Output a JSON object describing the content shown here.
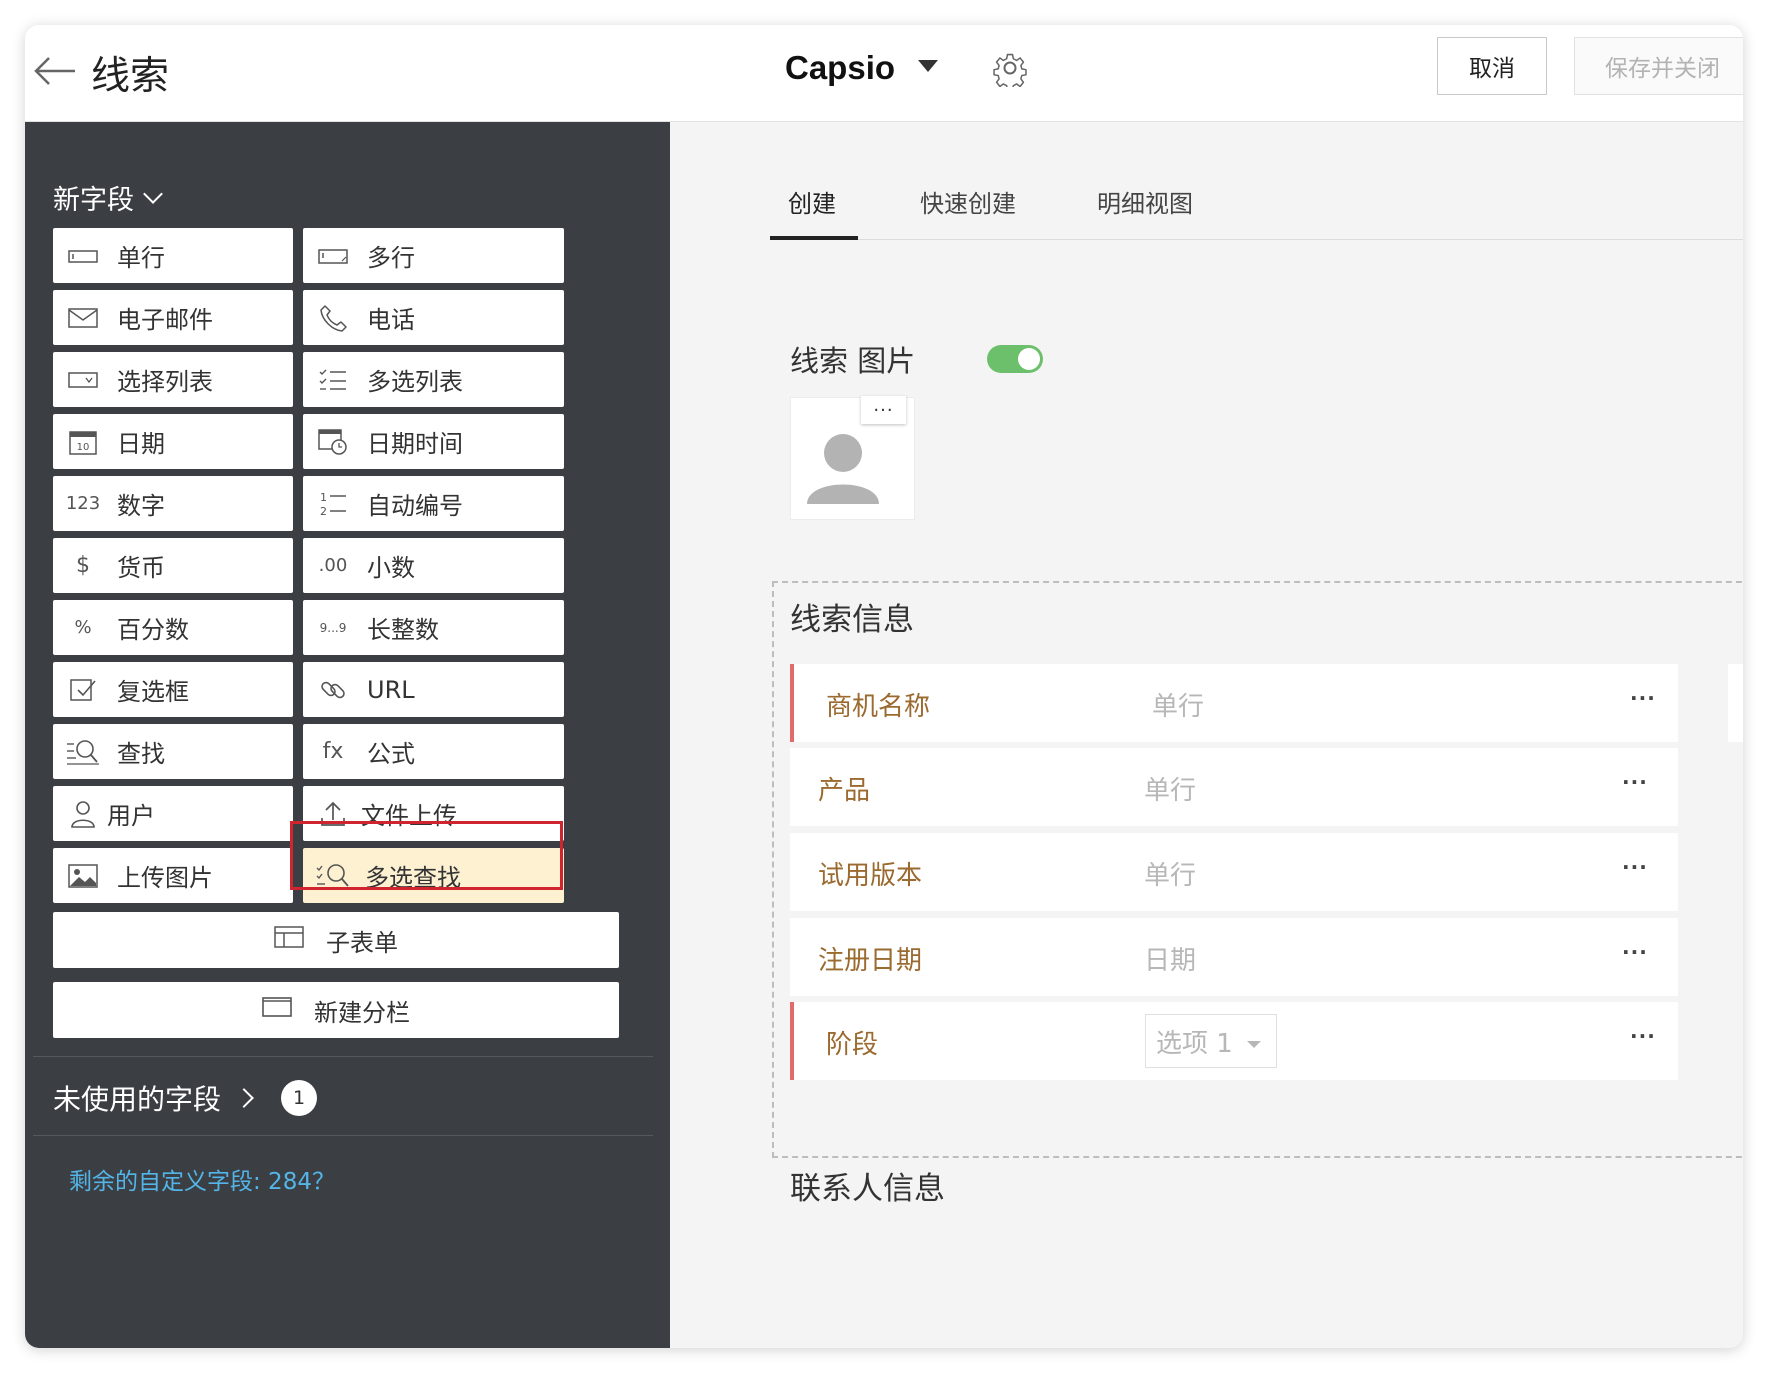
{
  "header": {
    "title": "线索",
    "layout_name": "Capsio",
    "cancel_label": "取消",
    "save_label": "保存并关闭"
  },
  "sidebar": {
    "new_field_label": "新字段",
    "fields": [
      {
        "label": "单行",
        "icon": "single-line-icon"
      },
      {
        "label": "多行",
        "icon": "multi-line-icon"
      },
      {
        "label": "电子邮件",
        "icon": "mail-icon"
      },
      {
        "label": "电话",
        "icon": "phone-icon"
      },
      {
        "label": "选择列表",
        "icon": "picklist-icon"
      },
      {
        "label": "多选列表",
        "icon": "multi-picklist-icon"
      },
      {
        "label": "日期",
        "icon": "calendar-icon",
        "icon_text": "10"
      },
      {
        "label": "日期时间",
        "icon": "calendar-clock-icon"
      },
      {
        "label": "数字",
        "icon": "number-icon",
        "icon_text": "123"
      },
      {
        "label": "自动编号",
        "icon": "auto-number-icon"
      },
      {
        "label": "货币",
        "icon": "dollar-icon",
        "icon_text": "$"
      },
      {
        "label": "小数",
        "icon": "decimal-icon",
        "icon_text": ".00"
      },
      {
        "label": "百分数",
        "icon": "percent-icon",
        "icon_text": "%"
      },
      {
        "label": "长整数",
        "icon": "long-integer-icon",
        "icon_text": "9...9"
      },
      {
        "label": "复选框",
        "icon": "checkbox-icon"
      },
      {
        "label": "URL",
        "icon": "link-icon"
      },
      {
        "label": "查找",
        "icon": "lookup-icon"
      },
      {
        "label": "公式",
        "icon": "formula-icon",
        "icon_text": "fx"
      },
      {
        "label": "用户",
        "icon": "user-icon"
      },
      {
        "label": "文件上传",
        "icon": "upload-icon"
      },
      {
        "label": "上传图片",
        "icon": "image-icon"
      },
      {
        "label": "多选查找",
        "icon": "multi-lookup-icon"
      }
    ],
    "subform_label": "子表单",
    "new_section_label": "新建分栏",
    "unused_label": "未使用的字段",
    "unused_count": "1",
    "remaining_label": "剩余的自定义字段: 284？"
  },
  "main": {
    "tabs": [
      {
        "label": "创建"
      },
      {
        "label": "快速创建"
      },
      {
        "label": "明细视图"
      }
    ],
    "photo_label": "线索 图片",
    "photo_menu": "···",
    "section_title": "线索信息",
    "rows": [
      {
        "label": "商机名称",
        "type": "单行",
        "more": "···"
      },
      {
        "label": "产品",
        "type": "单行",
        "more": "···"
      },
      {
        "label": "试用版本",
        "type": "单行",
        "more": "···"
      },
      {
        "label": "注册日期",
        "type": "日期",
        "more": "···"
      },
      {
        "label": "阶段",
        "type": "选项 1",
        "more": "···"
      }
    ],
    "contact_section_title": "联系人信息"
  },
  "colors": {
    "sidebar_bg": "#3b3f44",
    "highlight_fill": "#fdf1d2",
    "highlight_border": "#d0252e",
    "toggle_on": "#6cc06b",
    "field_label": "#9a6a2f",
    "required_marker": "#e06c6c",
    "link": "#53b5e8"
  }
}
